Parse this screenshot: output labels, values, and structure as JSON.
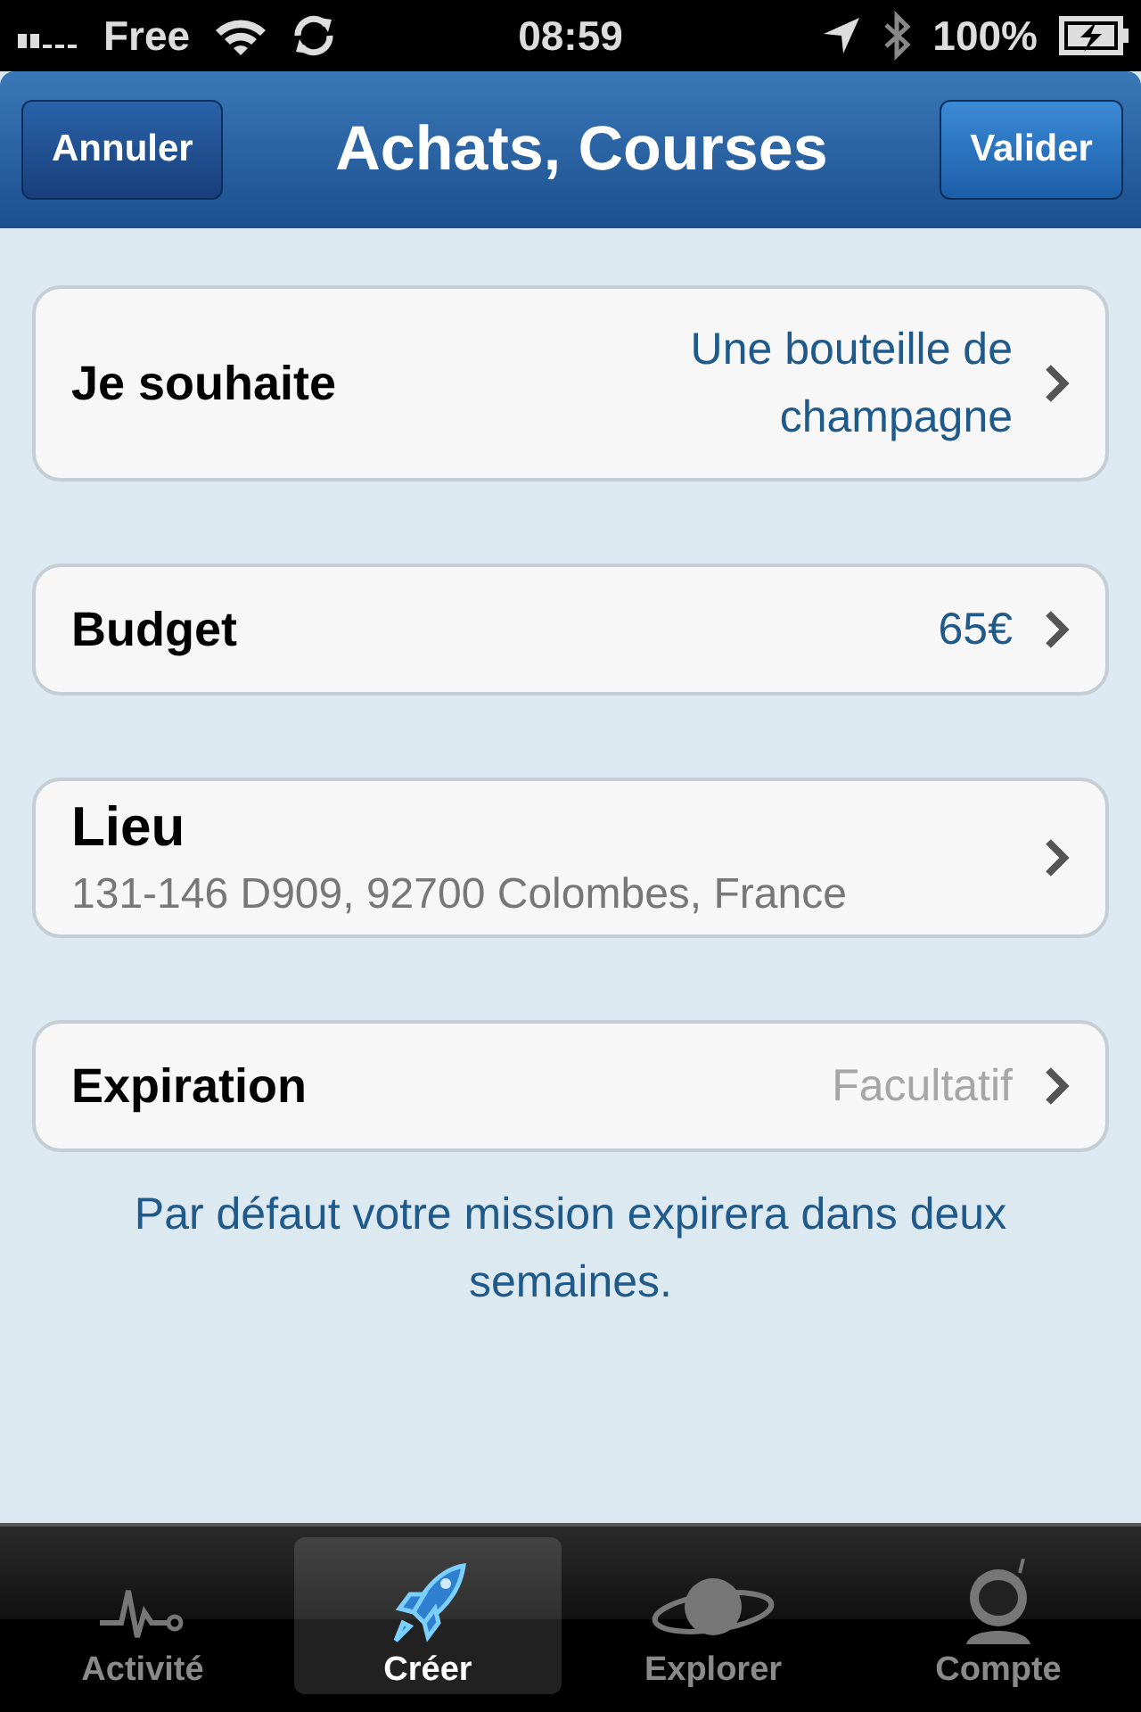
{
  "status_bar": {
    "carrier": "Free",
    "time": "08:59",
    "battery": "100%"
  },
  "nav_bar": {
    "title": "Achats, Courses",
    "left_button": "Annuler",
    "right_button": "Valider"
  },
  "rows": [
    {
      "kind": "value",
      "label": "Je souhaite",
      "value": "Une bouteille de champagne"
    },
    {
      "kind": "value",
      "label": "Budget",
      "value": "65€"
    },
    {
      "kind": "subtitle",
      "label": "Lieu",
      "value": "131-146 D909, 92700 Colombes, France"
    },
    {
      "kind": "placeholder",
      "label": "Expiration",
      "placeholder": "Facultatif"
    }
  ],
  "note": "Par défaut votre mission expirera dans deux semaines.",
  "tab_bar": [
    {
      "label": "Activité",
      "selected": false
    },
    {
      "label": "Créer",
      "selected": true
    },
    {
      "label": "Explorer",
      "selected": false
    },
    {
      "label": "Compte",
      "selected": false
    }
  ]
}
